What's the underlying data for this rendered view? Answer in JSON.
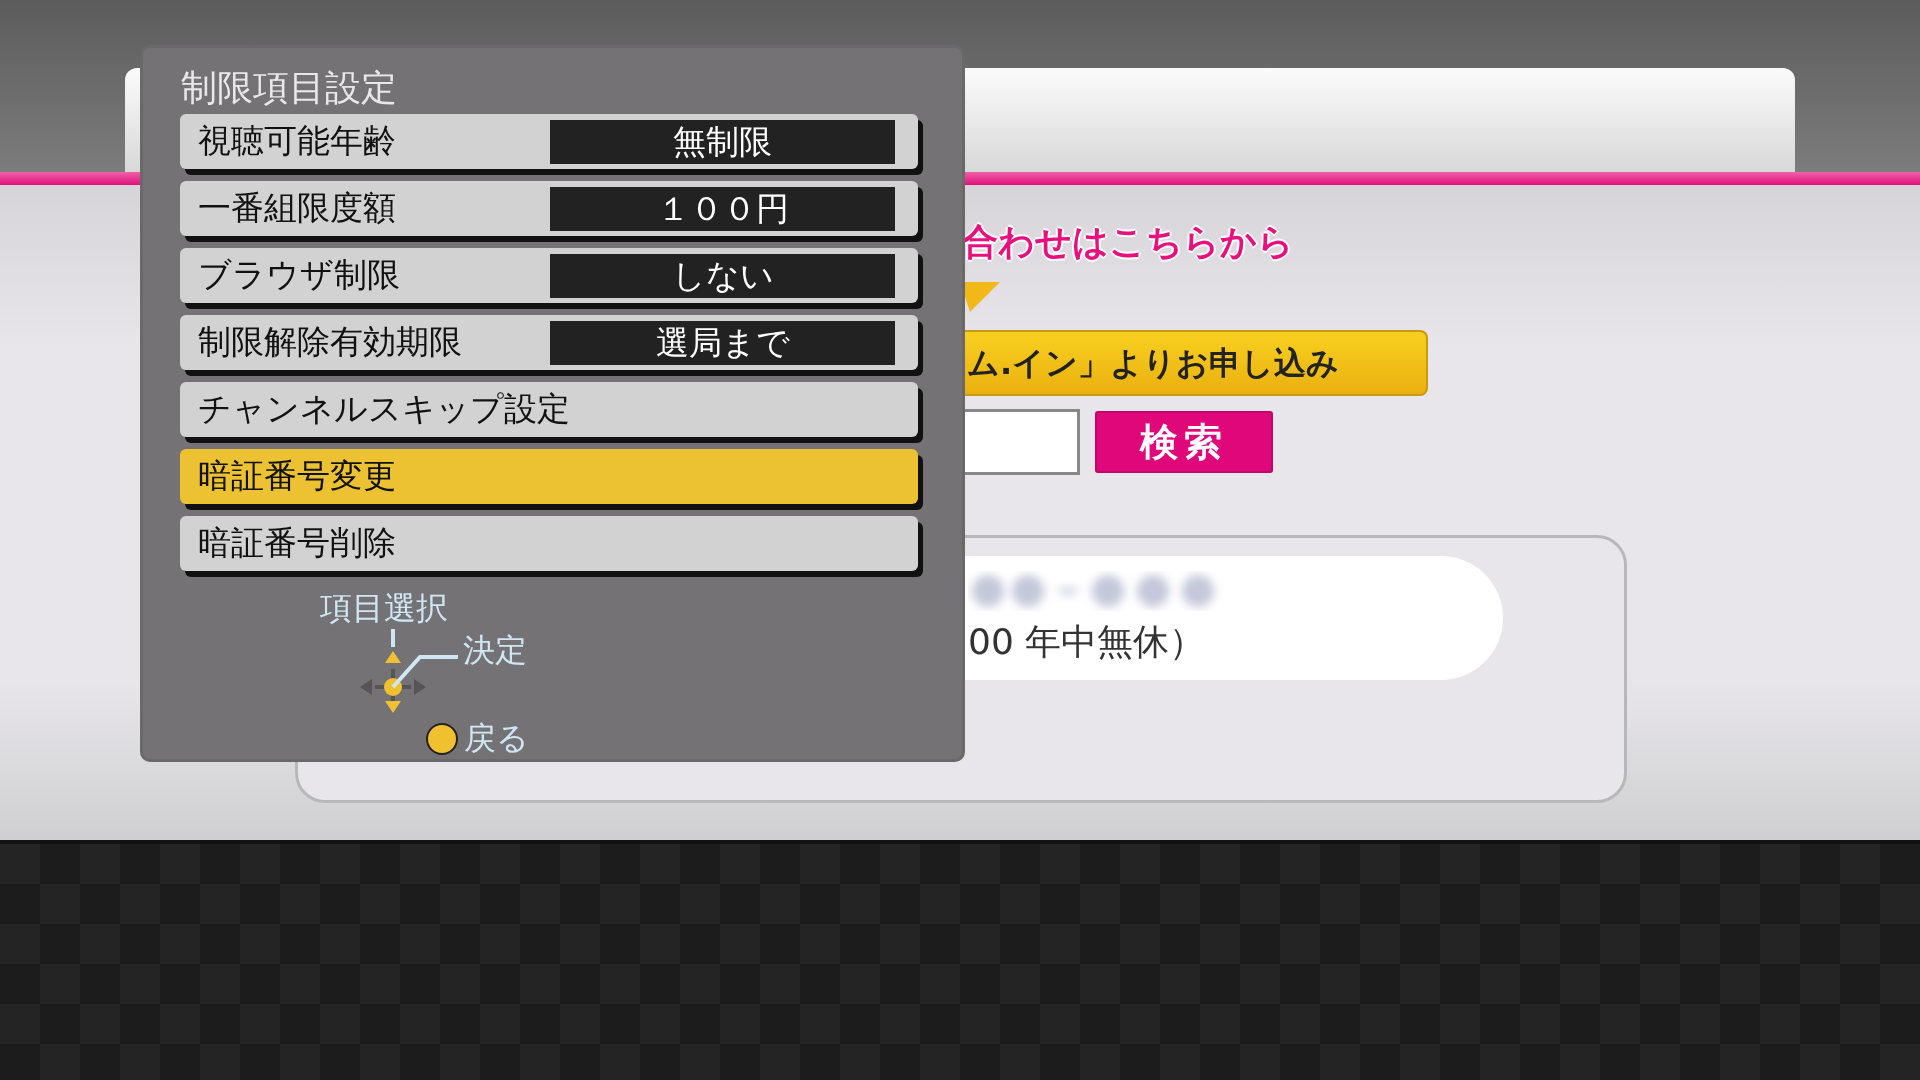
{
  "settings_menu": {
    "title": "制限項目設定",
    "items": [
      {
        "label": "視聴可能年齢",
        "value": "無制限",
        "selected": false
      },
      {
        "label": "一番組限度額",
        "value": "１００円",
        "selected": false
      },
      {
        "label": "ブラウザ制限",
        "value": "しない",
        "selected": false
      },
      {
        "label": "制限解除有効期限",
        "value": "選局まで",
        "selected": false
      },
      {
        "label": "チャンネルスキップ設定",
        "selected": false
      },
      {
        "label": "暗証番号変更",
        "selected": true
      },
      {
        "label": "暗証番号削除",
        "selected": false
      }
    ]
  },
  "controls_guide": {
    "select": "項目選択",
    "confirm": "決定",
    "back": "戻る"
  },
  "page": {
    "heading": "合わせはこちらから",
    "banner": "ム.イン」よりお申し込み",
    "search_button": "検索",
    "hours": "00 年中無休）"
  }
}
